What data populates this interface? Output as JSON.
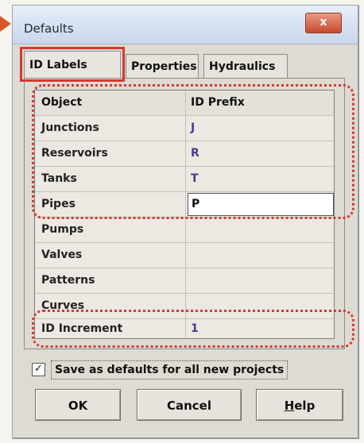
{
  "window": {
    "title": "Defaults",
    "close_glyph": "x"
  },
  "tabs": [
    {
      "label": "ID Labels"
    },
    {
      "label": "Properties"
    },
    {
      "label": "Hydraulics"
    }
  ],
  "grid": {
    "header": {
      "object": "Object",
      "prefix": "ID Prefix"
    },
    "rows": [
      {
        "object": "Junctions",
        "prefix": "J"
      },
      {
        "object": "Reservoirs",
        "prefix": "R"
      },
      {
        "object": "Tanks",
        "prefix": "T"
      },
      {
        "object": "Pipes",
        "prefix": "P"
      },
      {
        "object": "Pumps",
        "prefix": ""
      },
      {
        "object": "Valves",
        "prefix": ""
      },
      {
        "object": "Patterns",
        "prefix": ""
      },
      {
        "object": "Curves",
        "prefix": ""
      },
      {
        "object": "ID Increment",
        "prefix": "1"
      }
    ]
  },
  "checkbox": {
    "label": "Save as defaults for all new projects",
    "checked_glyph": "✓"
  },
  "buttons": {
    "ok": "OK",
    "cancel": "Cancel",
    "help_first": "H",
    "help_rest": "elp"
  },
  "colors": {
    "highlight": "#d23b30",
    "prefix_text": "#4a3a9a"
  }
}
